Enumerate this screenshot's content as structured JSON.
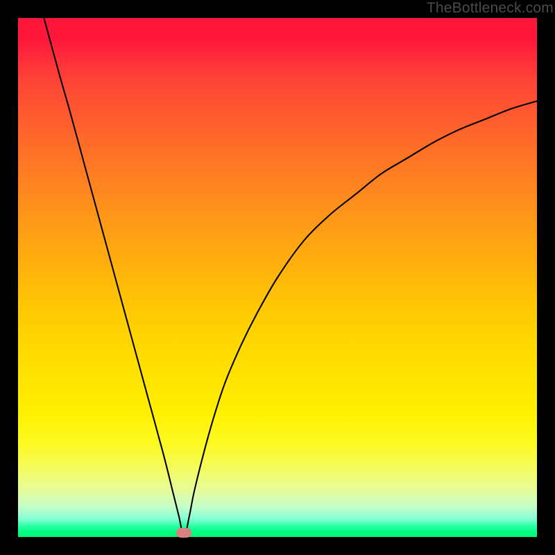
{
  "watermark": "TheBottleneck.com",
  "colors": {
    "frame": "#000000",
    "curve": "#000000",
    "marker": "#d98080"
  },
  "chart_data": {
    "type": "line",
    "title": "",
    "xlabel": "",
    "ylabel": "",
    "xlim": [
      0,
      100
    ],
    "ylim": [
      0,
      100
    ],
    "grid": false,
    "legend": false,
    "curve": {
      "description": "V-shaped bottleneck curve (y = deviation/bottleneck %, x = relative component performance). Minimum (y≈0) at x≈32.",
      "x": [
        5,
        8,
        10,
        13,
        16,
        19,
        22,
        25,
        28,
        30,
        31,
        32,
        33,
        34,
        36,
        38,
        40,
        43,
        46,
        50,
        55,
        60,
        65,
        70,
        75,
        80,
        85,
        90,
        95,
        100
      ],
      "y": [
        100,
        89,
        82,
        71,
        60,
        49,
        38,
        27,
        16,
        8,
        4,
        0,
        4,
        9,
        17,
        24,
        30,
        37,
        43,
        50,
        57,
        62,
        66,
        70,
        73,
        76,
        78.5,
        80.5,
        82.5,
        84
      ]
    },
    "marker": {
      "x": 32,
      "y": 0
    },
    "annotations": []
  }
}
